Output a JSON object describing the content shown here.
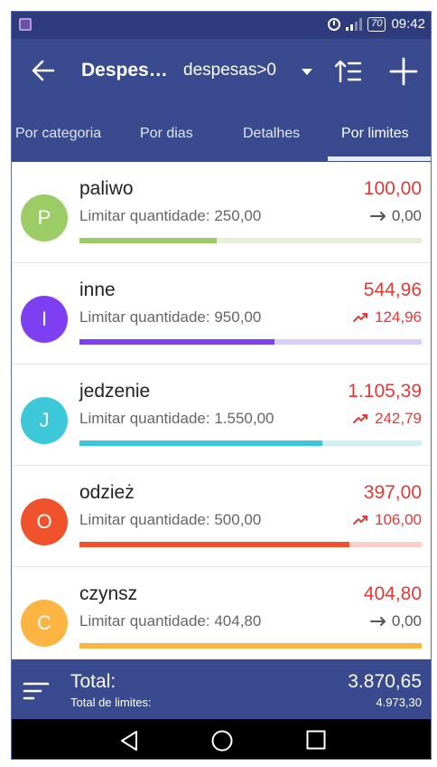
{
  "status_bar": {
    "battery": "70",
    "time": "09:42"
  },
  "app_bar": {
    "title": "Despes…",
    "filter": "despesas>0"
  },
  "tabs": [
    {
      "label": "Por categoria"
    },
    {
      "label": "Por dias"
    },
    {
      "label": "Detalhes"
    },
    {
      "label": "Por limites",
      "active": true
    }
  ],
  "limit_prefix": "Limitar quantidade:",
  "items": [
    {
      "initial": "P",
      "name": "paliwo",
      "limit": "250,00",
      "amount": "100,00",
      "delta": "0,00",
      "trend": "flat",
      "progress": 0.4,
      "color": "#9ccc65",
      "track": "#e4f1d6",
      "delta_color": "#555555"
    },
    {
      "initial": "I",
      "name": "inne",
      "limit": "950,00",
      "amount": "544,96",
      "delta": "124,96",
      "trend": "up",
      "progress": 0.57,
      "color": "#7e3ff2",
      "track": "#dccdf8",
      "delta_color": "#e53935"
    },
    {
      "initial": "J",
      "name": "jedzenie",
      "limit": "1.550,00",
      "amount": "1.105,39",
      "delta": "242,79",
      "trend": "up",
      "progress": 0.71,
      "color": "#3cc8d8",
      "track": "#cff1f5",
      "delta_color": "#e53935"
    },
    {
      "initial": "O",
      "name": "odzież",
      "limit": "500,00",
      "amount": "397,00",
      "delta": "106,00",
      "trend": "up",
      "progress": 0.79,
      "color": "#f0522b",
      "track": "#fcd0c6",
      "delta_color": "#e53935"
    },
    {
      "initial": "C",
      "name": "czynsz",
      "limit": "404,80",
      "amount": "404,80",
      "delta": "0,00",
      "trend": "flat",
      "progress": 1.0,
      "color": "#fbb540",
      "track": "#fde8c2",
      "delta_color": "#555555"
    }
  ],
  "footer": {
    "total_label": "Total:",
    "limits_label": "Total de limites:",
    "total_value": "3.870,65",
    "limits_value": "4.973,30"
  },
  "colors": {
    "primary": "#3a4a8e",
    "status_bar": "#2e3b7c",
    "amount": "#e53935"
  }
}
